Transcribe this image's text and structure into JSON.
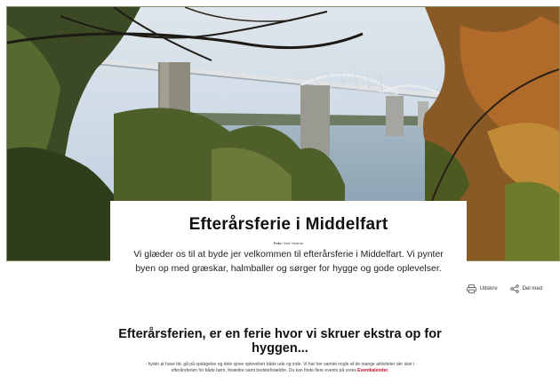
{
  "hero": {
    "image_description_name": "bridge-photo",
    "colors": {
      "sky": "#c9d7e4",
      "water": "#8ea5b6",
      "foliage_dark": "#3b4a24",
      "foliage_autumn": "#b06a2a"
    }
  },
  "intro": {
    "title": "Efterårsferie i Middelfart",
    "photo_credit_label": "Foto:",
    "photo_credit_name": "Nick Hortrue",
    "text": "Vi glæder os til at byde jer velkommen til efterårsferie i Middelfart. Vi pynter byen op med græskar, halmballer og sørger for hygge og gode oplevelser."
  },
  "actions": {
    "print_label": "Udskriv",
    "print_icon": "printer-icon",
    "share_label": "Del med",
    "share_icon": "share-icon"
  },
  "section": {
    "title": "Efterårsferien, er en ferie hvor vi skruer ekstra op for hyggen...",
    "text": "- hyder at have tid, gå på opdagelse og dele sjove oplevelser både ude og inde. Vi har her samlet nogle af de mange aktiviteter der sker i efterårsferien for både børn, forældre samt bedsteforældre. Du kan finde flere events på vores",
    "link_label": "Eventkalender."
  },
  "colors": {
    "link": "#c8102e",
    "background": "#ffffff"
  }
}
